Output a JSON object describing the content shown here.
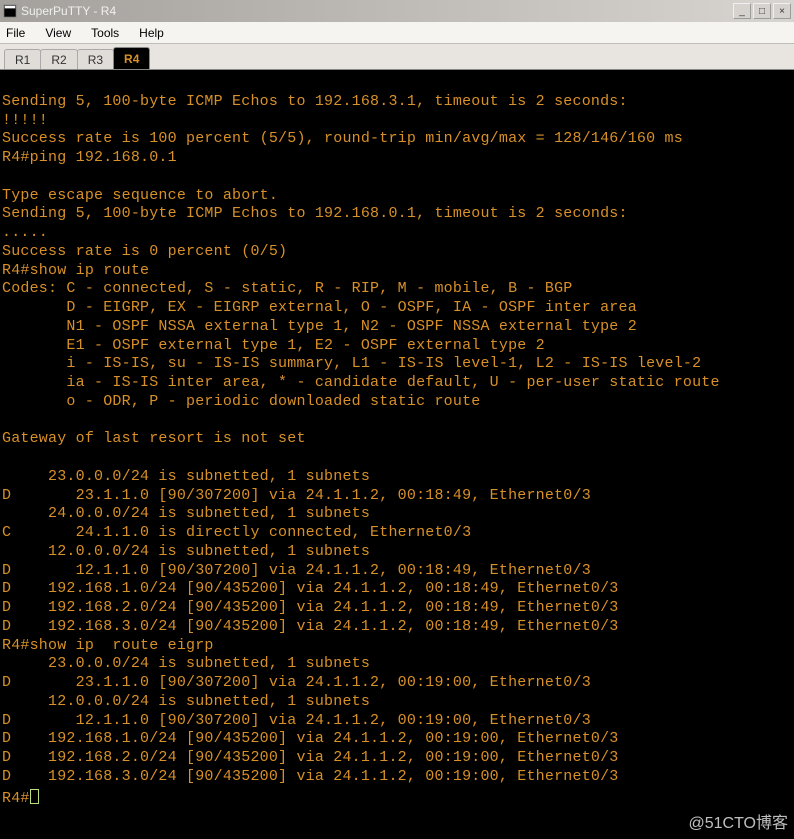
{
  "window": {
    "title": "SuperPuTTY - R4"
  },
  "menu": {
    "file": "File",
    "view": "View",
    "tools": "Tools",
    "help": "Help"
  },
  "tabs": {
    "r1": "R1",
    "r2": "R2",
    "r3": "R3",
    "r4": "R4"
  },
  "terminal": {
    "lines": [
      "",
      "Sending 5, 100-byte ICMP Echos to 192.168.3.1, timeout is 2 seconds:",
      "!!!!!",
      "Success rate is 100 percent (5/5), round-trip min/avg/max = 128/146/160 ms",
      "R4#ping 192.168.0.1",
      "",
      "Type escape sequence to abort.",
      "Sending 5, 100-byte ICMP Echos to 192.168.0.1, timeout is 2 seconds:",
      ".....",
      "Success rate is 0 percent (0/5)",
      "R4#show ip route",
      "Codes: C - connected, S - static, R - RIP, M - mobile, B - BGP",
      "       D - EIGRP, EX - EIGRP external, O - OSPF, IA - OSPF inter area",
      "       N1 - OSPF NSSA external type 1, N2 - OSPF NSSA external type 2",
      "       E1 - OSPF external type 1, E2 - OSPF external type 2",
      "       i - IS-IS, su - IS-IS summary, L1 - IS-IS level-1, L2 - IS-IS level-2",
      "       ia - IS-IS inter area, * - candidate default, U - per-user static route",
      "       o - ODR, P - periodic downloaded static route",
      "",
      "Gateway of last resort is not set",
      "",
      "     23.0.0.0/24 is subnetted, 1 subnets",
      "D       23.1.1.0 [90/307200] via 24.1.1.2, 00:18:49, Ethernet0/3",
      "     24.0.0.0/24 is subnetted, 1 subnets",
      "C       24.1.1.0 is directly connected, Ethernet0/3",
      "     12.0.0.0/24 is subnetted, 1 subnets",
      "D       12.1.1.0 [90/307200] via 24.1.1.2, 00:18:49, Ethernet0/3",
      "D    192.168.1.0/24 [90/435200] via 24.1.1.2, 00:18:49, Ethernet0/3",
      "D    192.168.2.0/24 [90/435200] via 24.1.1.2, 00:18:49, Ethernet0/3",
      "D    192.168.3.0/24 [90/435200] via 24.1.1.2, 00:18:49, Ethernet0/3",
      "R4#show ip  route eigrp",
      "     23.0.0.0/24 is subnetted, 1 subnets",
      "D       23.1.1.0 [90/307200] via 24.1.1.2, 00:19:00, Ethernet0/3",
      "     12.0.0.0/24 is subnetted, 1 subnets",
      "D       12.1.1.0 [90/307200] via 24.1.1.2, 00:19:00, Ethernet0/3",
      "D    192.168.1.0/24 [90/435200] via 24.1.1.2, 00:19:00, Ethernet0/3",
      "D    192.168.2.0/24 [90/435200] via 24.1.1.2, 00:19:00, Ethernet0/3",
      "D    192.168.3.0/24 [90/435200] via 24.1.1.2, 00:19:00, Ethernet0/3"
    ],
    "prompt": "R4#"
  },
  "watermark": "@51CTO博客",
  "controls": {
    "minimize": "_",
    "maximize": "□",
    "close": "×"
  }
}
